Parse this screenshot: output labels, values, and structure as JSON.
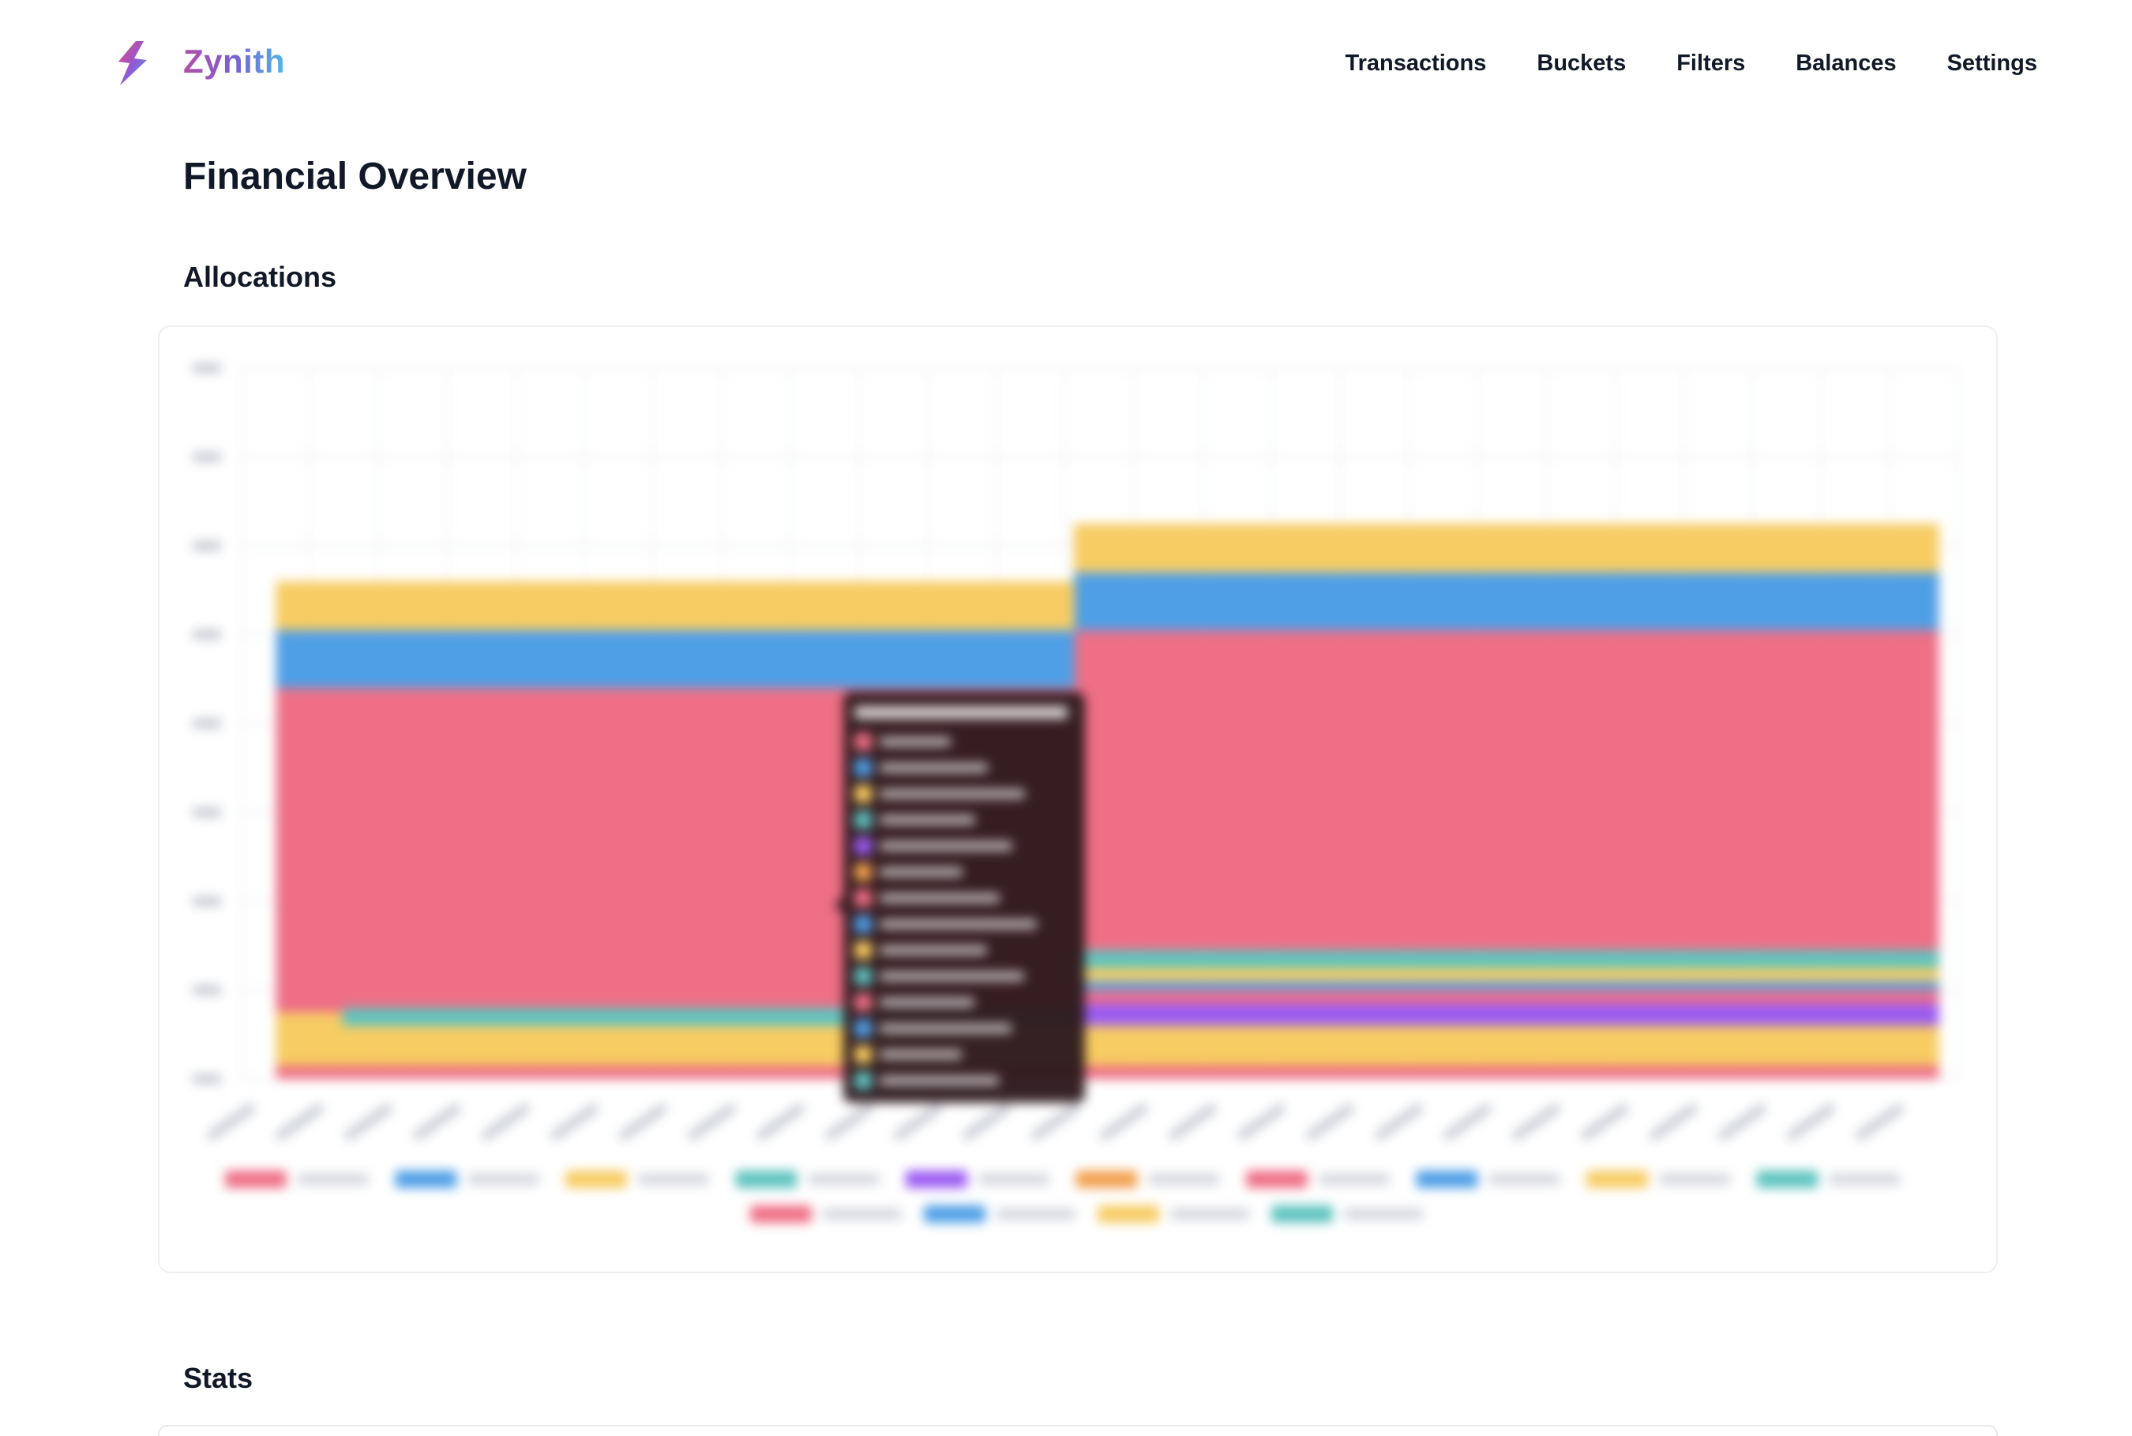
{
  "app": {
    "name": "Zynith",
    "logo_colors": [
      "#e8457a",
      "#8d5bd6",
      "#3fb8d8"
    ]
  },
  "nav": {
    "items": [
      {
        "label": "Transactions"
      },
      {
        "label": "Buckets"
      },
      {
        "label": "Filters"
      },
      {
        "label": "Balances"
      },
      {
        "label": "Settings"
      }
    ]
  },
  "page": {
    "title": "Financial Overview"
  },
  "sections": {
    "allocations": "Allocations",
    "stats": "Stats"
  },
  "colors": {
    "red": "#ee6f86",
    "blue": "#4f9fe6",
    "yellow": "#f7cc63",
    "teal": "#5ec3bf",
    "purple": "#9b5cf2",
    "orange": "#f2a04e"
  },
  "chart_data": {
    "type": "area",
    "stacked": true,
    "step": true,
    "ylim": [
      0,
      160
    ],
    "yticks": [
      0,
      20,
      40,
      60,
      80,
      100,
      120,
      140,
      160
    ],
    "xtick_count": 25,
    "grid": true,
    "legend_position": "bottom",
    "series": [
      {
        "color": "#ee6f86",
        "values": [
          3,
          3,
          3,
          3,
          3,
          3,
          3,
          3,
          3,
          3,
          3,
          3,
          3,
          3,
          3,
          3,
          3,
          3,
          3,
          3,
          3,
          3,
          3,
          3,
          3
        ]
      },
      {
        "color": "#f7cc63",
        "values": [
          12,
          9,
          9,
          9,
          9,
          9,
          9,
          9,
          9,
          9,
          9,
          9,
          9,
          9,
          9,
          9,
          9,
          9,
          9,
          9,
          9,
          9,
          9,
          9,
          9
        ]
      },
      {
        "color": "#5ec3bf",
        "values": [
          0,
          4,
          4,
          4,
          4,
          4,
          4,
          4,
          4,
          4,
          4,
          4,
          0,
          0,
          0,
          0,
          0,
          0,
          0,
          0,
          0,
          0,
          0,
          0,
          0
        ]
      },
      {
        "color": "#9b5cf2",
        "values": [
          0,
          0,
          0,
          0,
          0,
          0,
          0,
          0,
          0,
          0,
          0,
          0,
          5,
          5,
          5,
          5,
          5,
          5,
          5,
          5,
          5,
          5,
          5,
          5,
          5
        ]
      },
      {
        "color": "#ee6f86",
        "values": [
          0,
          0,
          0,
          0,
          0,
          0,
          0,
          0,
          0,
          0,
          0,
          0,
          3,
          3,
          3,
          3,
          3,
          3,
          3,
          3,
          3,
          3,
          3,
          3,
          3
        ]
      },
      {
        "color": "#4f9fe6",
        "values": [
          0,
          0,
          0,
          0,
          0,
          0,
          0,
          0,
          0,
          0,
          0,
          0,
          2,
          2,
          2,
          2,
          2,
          2,
          2,
          2,
          2,
          2,
          2,
          2,
          2
        ]
      },
      {
        "color": "#f7cc63",
        "values": [
          0,
          0,
          0,
          0,
          0,
          0,
          0,
          0,
          0,
          0,
          0,
          0,
          3,
          3,
          3,
          3,
          3,
          3,
          3,
          3,
          3,
          3,
          3,
          3,
          3
        ]
      },
      {
        "color": "#5ec3bf",
        "values": [
          0,
          0,
          0,
          0,
          0,
          0,
          0,
          0,
          0,
          0,
          0,
          0,
          4,
          4,
          4,
          4,
          4,
          4,
          4,
          4,
          4,
          4,
          4,
          4,
          4
        ]
      },
      {
        "color": "#ee6f86",
        "values": [
          73,
          72,
          72,
          72,
          72,
          72,
          72,
          72,
          72,
          72,
          72,
          72,
          72,
          72,
          72,
          72,
          72,
          72,
          72,
          72,
          72,
          72,
          72,
          72,
          72
        ]
      },
      {
        "color": "#4f9fe6",
        "values": [
          13,
          13,
          13,
          13,
          13,
          13,
          13,
          13,
          13,
          13,
          13,
          13,
          13,
          13,
          13,
          13,
          13,
          13,
          13,
          13,
          13,
          13,
          13,
          13,
          13
        ]
      },
      {
        "color": "#f7cc63",
        "values": [
          11,
          11,
          11,
          11,
          11,
          11,
          11,
          11,
          11,
          11,
          11,
          11,
          11,
          11,
          11,
          11,
          11,
          11,
          11,
          11,
          11,
          11,
          11,
          11,
          11
        ]
      }
    ],
    "legend_colors": [
      "#ee6f86",
      "#4f9fe6",
      "#f7cc63",
      "#5ec3bf",
      "#9b5cf2",
      "#f2a04e",
      "#ee6f86",
      "#4f9fe6",
      "#f7cc63",
      "#5ec3bf",
      "#ee6f86",
      "#4f9fe6",
      "#f7cc63",
      "#5ec3bf"
    ],
    "tooltip_colors": [
      "#ee6f86",
      "#4f9fe6",
      "#f7cc63",
      "#5ec3bf",
      "#9b5cf2",
      "#f2a04e",
      "#ee6f86",
      "#4f9fe6",
      "#f7cc63",
      "#5ec3bf",
      "#ee6f86",
      "#4f9fe6",
      "#f7cc63",
      "#5ec3bf"
    ]
  }
}
